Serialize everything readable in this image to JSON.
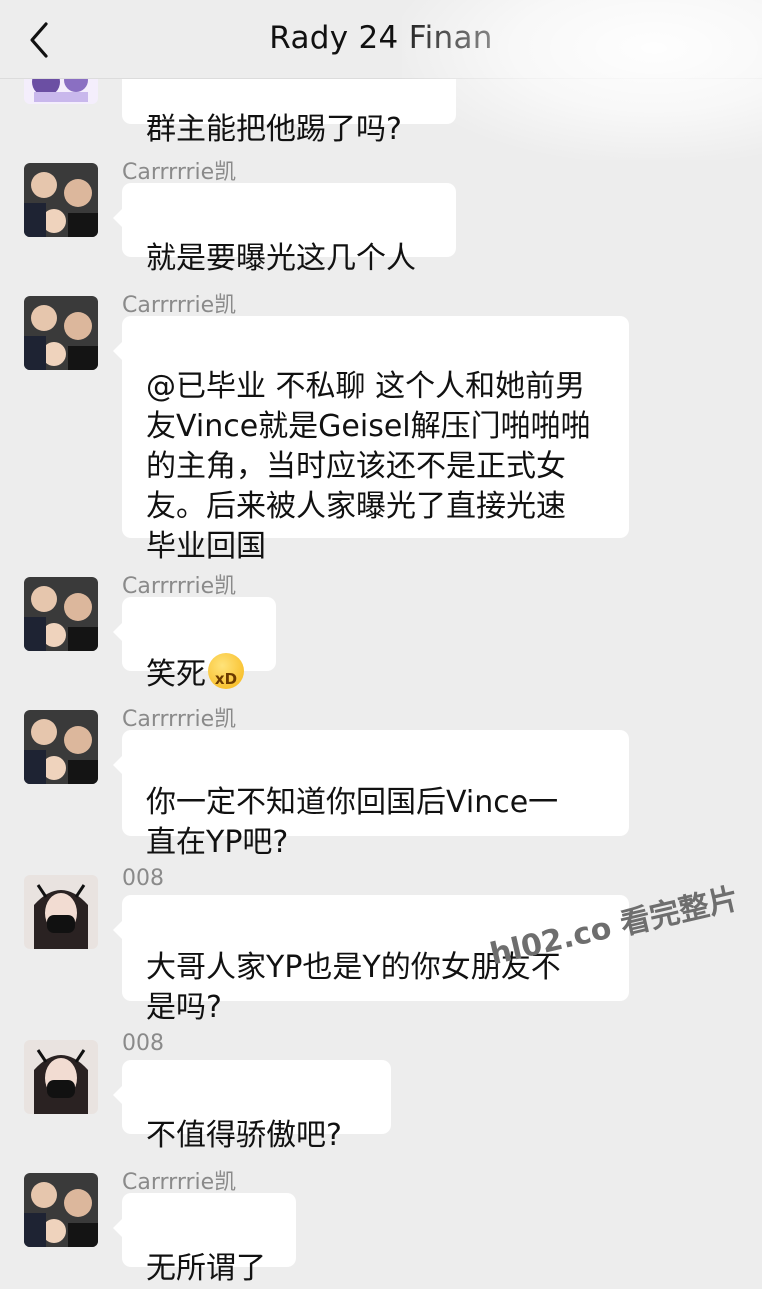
{
  "header": {
    "title": "Rady 24 Finan"
  },
  "messages": [
    {
      "sender": "",
      "text": "群主能把他踢了吗?",
      "avatar": "anime-avatar-icon"
    },
    {
      "sender": "Carrrrrie凯",
      "text": "就是要曝光这几个人",
      "avatar": "group-photo-avatar"
    },
    {
      "sender": "Carrrrrie凯",
      "text": "@已毕业 不私聊 这个人和她前男\n友Vince就是Geisel解压门啪啪啪\n的主角，当时应该还不是正式女\n友。后来被人家曝光了直接光速\n毕业回国",
      "avatar": "group-photo-avatar"
    },
    {
      "sender": "Carrrrrie凯",
      "text": "笑死",
      "emoji": "laughing-emoji",
      "avatar": "group-photo-avatar"
    },
    {
      "sender": "Carrrrrie凯",
      "text": "你一定不知道你回国后Vince一\n直在YP吧?",
      "avatar": "group-photo-avatar"
    },
    {
      "sender": "008",
      "text": "大哥人家YP也是Y的你女朋友不\n是吗?",
      "avatar": "masked-girl-avatar"
    },
    {
      "sender": "008",
      "text": "不值得骄傲吧?",
      "avatar": "masked-girl-avatar"
    },
    {
      "sender": "Carrrrrie凯",
      "text": "无所谓了",
      "avatar": "group-photo-avatar"
    }
  ],
  "watermark": "hl02.co 看完整片",
  "colors": {
    "background": "#ededed",
    "bubble": "#ffffff",
    "sender": "#8a8a8a"
  }
}
